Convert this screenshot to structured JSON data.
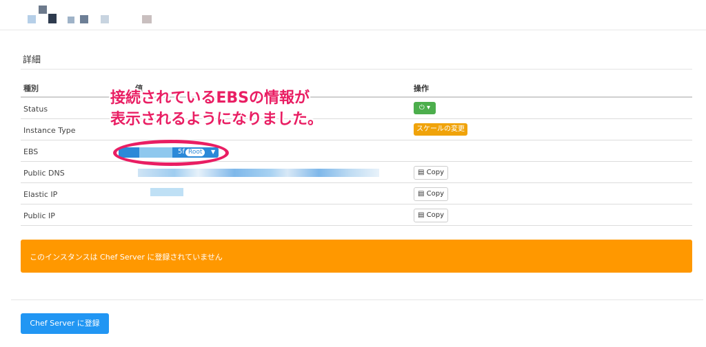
{
  "section": {
    "title": "詳細"
  },
  "table": {
    "headers": {
      "kind": "種別",
      "value": "値",
      "operation": "操作"
    },
    "rows": [
      {
        "label": "Status"
      },
      {
        "label": "Instance Type",
        "op": "スケールの変更"
      },
      {
        "label": "EBS",
        "ebs_suffix": "5f",
        "ebs_tag": "Root"
      },
      {
        "label": "Public DNS",
        "op": "Copy"
      },
      {
        "label": "Elastic IP",
        "op": "Copy"
      },
      {
        "label": "Public IP",
        "op": "Copy"
      }
    ]
  },
  "annotation": {
    "line1": "接続されているEBSの情報が",
    "line2": "表示されるようになりました。"
  },
  "alert": {
    "text": "このインスタンスは Chef Server に登録されていません"
  },
  "register_button": "Chef Server に登録",
  "colors": {
    "status": "#4cae4c",
    "scale": "#f0a30a",
    "alert": "#ff9800",
    "primary": "#2196f3",
    "annotation": "#e91e63"
  }
}
